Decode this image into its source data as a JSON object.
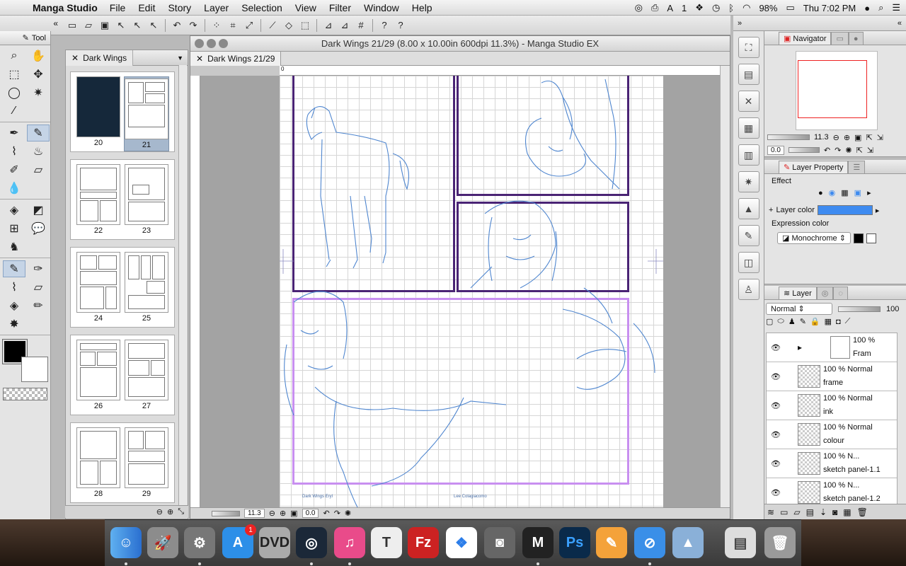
{
  "menubar": {
    "app_name": "Manga Studio",
    "menus": [
      "File",
      "Edit",
      "Story",
      "Layer",
      "Selection",
      "View",
      "Filter",
      "Window",
      "Help"
    ],
    "status": {
      "badge_count": "1",
      "battery": "98%",
      "clock": "Thu 7:02 PM"
    }
  },
  "toolpanel": {
    "title": "Tool"
  },
  "pagepanel": {
    "tab_label": "Dark Wings",
    "pages": [
      {
        "left": "20",
        "right": "21"
      },
      {
        "left": "22",
        "right": "23"
      },
      {
        "left": "24",
        "right": "25"
      },
      {
        "left": "26",
        "right": "27"
      },
      {
        "left": "28",
        "right": "29"
      }
    ]
  },
  "canvas": {
    "window_title": "Dark Wings 21/29 (8.00 x 10.00in 600dpi 11.3%)  - Manga Studio EX",
    "tab_label": "Dark Wings 21/29",
    "ruler_zero": "0",
    "zoom": "11.3",
    "rotation": "0.0",
    "credit_left": "Dark Wings Eryl",
    "credit_right": "Lee Colagiacomo"
  },
  "navigator": {
    "tab_label": "Navigator",
    "zoom": "11.3",
    "rotation": "0.0"
  },
  "layer_property": {
    "tab_label": "Layer Property",
    "effect_label": "Effect",
    "layer_color_label": "Layer color",
    "expression_color_label": "Expression color",
    "expression_mode": "Monochrome",
    "layer_color_hex": "#3e8bf0"
  },
  "layer": {
    "tab_label": "Layer",
    "blend_mode": "Normal",
    "opacity": "100",
    "rows": [
      {
        "line1": "100 %",
        "line2": "Fram"
      },
      {
        "line1": "100 % Normal",
        "line2": "frame"
      },
      {
        "line1": "100 % Normal",
        "line2": "ink"
      },
      {
        "line1": "100 % Normal",
        "line2": "colour"
      },
      {
        "line1": "100 % N...",
        "line2": "sketch panel-1.1"
      },
      {
        "line1": "100 % N...",
        "line2": "sketch panel-1.2"
      }
    ]
  },
  "colors": {
    "panel_frame": "#4a2475",
    "panel_pink": "#c88ff0",
    "sketch_blue": "#4f86cf"
  }
}
